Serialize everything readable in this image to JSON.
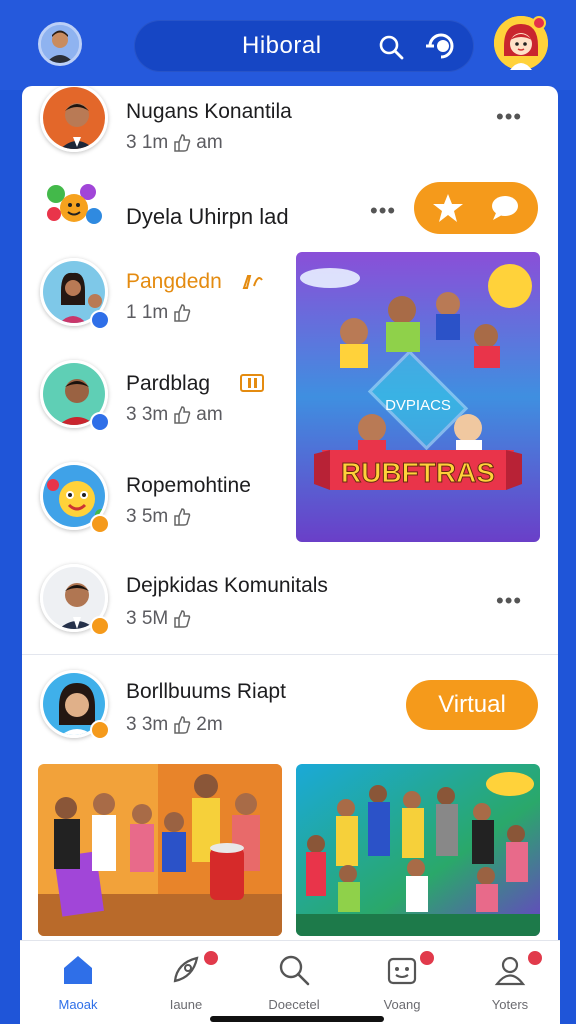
{
  "header": {
    "title": "Hiboral",
    "icons": [
      "avatar",
      "search-icon",
      "refresh-icon",
      "profile-icon"
    ]
  },
  "feed": {
    "items": [
      {
        "name": "Nugans Konantila",
        "meta": "3 1m",
        "meta2": "am"
      },
      {
        "name": "Dyela Uhirpn lad"
      },
      {
        "name": "Pangdedn",
        "meta": "1 1m"
      },
      {
        "name": "Pardblag",
        "meta": "3 3m",
        "meta2": "am"
      },
      {
        "name": "Ropemohtine",
        "meta": "3 5m"
      },
      {
        "name": "Dejpkidas Komunitals",
        "meta": "3 5M"
      },
      {
        "name": "Borllbuums Riapt",
        "meta": "3 3m",
        "meta2": "2m"
      }
    ],
    "virtual_label": "Virtual",
    "feature_image": {
      "big_text": "RUBFTRAS",
      "small_text": "DVPIACS"
    }
  },
  "bottom_nav": {
    "items": [
      {
        "label": "Maoak",
        "icon": "home-icon",
        "active": true
      },
      {
        "label": "Iaune",
        "icon": "rocket-icon",
        "badge": true
      },
      {
        "label": "Doecetel",
        "icon": "search-icon"
      },
      {
        "label": "Voang",
        "icon": "gift-icon",
        "badge": true
      },
      {
        "label": "Yoters",
        "icon": "user-icon",
        "badge": true
      }
    ]
  },
  "colors": {
    "brand_blue": "#2559dc",
    "accent_orange": "#f59a1b",
    "badge_red": "#e13a4b",
    "active_blue": "#2f6fe8"
  }
}
